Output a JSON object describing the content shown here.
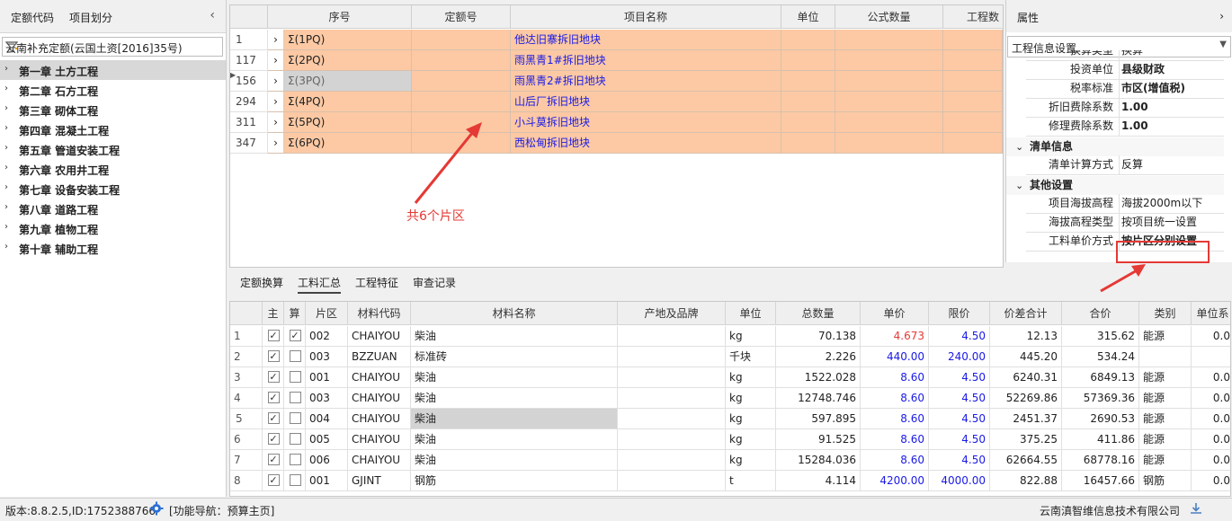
{
  "left_panel": {
    "tabs": [
      "定额代码",
      "项目划分"
    ],
    "quota_source": "云南补充定额(云国土资[2016]35号)",
    "chapters": [
      "第一章 土方工程",
      "第二章 石方工程",
      "第三章 砌体工程",
      "第四章 混凝土工程",
      "第五章 管道安装工程",
      "第六章 农用井工程",
      "第七章 设备安装工程",
      "第八章 道路工程",
      "第九章 植物工程",
      "第十章 辅助工程"
    ]
  },
  "top_grid": {
    "columns": [
      "序号",
      "定额号",
      "项目名称",
      "单位",
      "公式数量",
      "工程数"
    ],
    "rows": [
      {
        "num": "1",
        "seq": "Σ(1PQ)",
        "name": "他达旧寨拆旧地块"
      },
      {
        "num": "117",
        "seq": "Σ(2PQ)",
        "name": "雨黑青1#拆旧地块"
      },
      {
        "num": "156",
        "seq": "Σ(3PQ)",
        "name": "雨黑青2#拆旧地块"
      },
      {
        "num": "294",
        "seq": "Σ(4PQ)",
        "name": "山后厂拆旧地块"
      },
      {
        "num": "311",
        "seq": "Σ(5PQ)",
        "name": "小斗莫拆旧地块"
      },
      {
        "num": "347",
        "seq": "Σ(6PQ)",
        "name": "西松甸拆旧地块"
      }
    ],
    "annotation": "共6个片区"
  },
  "properties": {
    "title": "属性",
    "selector": "工程信息设置",
    "rows_top": [
      {
        "k": "换算类型",
        "v": "换算"
      },
      {
        "k": "投资单位",
        "v": "县级财政"
      },
      {
        "k": "税率标准",
        "v": "市区(增值税)"
      },
      {
        "k": "折旧费除系数",
        "v": "1.00"
      },
      {
        "k": "修理费除系数",
        "v": "1.00"
      }
    ],
    "group1": "清单信息",
    "rows_g1": [
      {
        "k": "清单计算方式",
        "v": "反算"
      }
    ],
    "group2": "其他设置",
    "rows_g2": [
      {
        "k": "项目海拔高程",
        "v": "海拔2000m以下"
      },
      {
        "k": "海拔高程类型",
        "v": "按项目统一设置"
      },
      {
        "k": "工料单价方式",
        "v": "按片区分别设置"
      }
    ]
  },
  "bottom_tabs": [
    "定额换算",
    "工料汇总",
    "工程特征",
    "审查记录"
  ],
  "bottom_grid": {
    "columns": [
      "主",
      "算",
      "片区",
      "材料代码",
      "材料名称",
      "产地及品牌",
      "单位",
      "总数量",
      "单价",
      "限价",
      "价差合计",
      "合价",
      "类别",
      "单位系"
    ],
    "rows": [
      {
        "n": "1",
        "area": "002",
        "code": "CHAIYOU",
        "name": "柴油",
        "unit": "kg",
        "qty": "70.138",
        "price": "4.673",
        "limit": "4.50",
        "diff": "12.13",
        "total": "315.62",
        "cat": "能源",
        "coef": "0.0",
        "m": true,
        "c": true
      },
      {
        "n": "2",
        "area": "003",
        "code": "BZZUAN",
        "name": "标准砖",
        "unit": "千块",
        "qty": "2.226",
        "price": "440.00",
        "limit": "240.00",
        "diff": "445.20",
        "total": "534.24",
        "cat": "",
        "coef": "",
        "m": true,
        "c": false
      },
      {
        "n": "3",
        "area": "001",
        "code": "CHAIYOU",
        "name": "柴油",
        "unit": "kg",
        "qty": "1522.028",
        "price": "8.60",
        "limit": "4.50",
        "diff": "6240.31",
        "total": "6849.13",
        "cat": "能源",
        "coef": "0.0",
        "m": true,
        "c": false
      },
      {
        "n": "4",
        "area": "003",
        "code": "CHAIYOU",
        "name": "柴油",
        "unit": "kg",
        "qty": "12748.746",
        "price": "8.60",
        "limit": "4.50",
        "diff": "52269.86",
        "total": "57369.36",
        "cat": "能源",
        "coef": "0.0",
        "m": true,
        "c": false
      },
      {
        "n": "5",
        "area": "004",
        "code": "CHAIYOU",
        "name": "柴油",
        "unit": "kg",
        "qty": "597.895",
        "price": "8.60",
        "limit": "4.50",
        "diff": "2451.37",
        "total": "2690.53",
        "cat": "能源",
        "coef": "0.0",
        "m": true,
        "c": false
      },
      {
        "n": "6",
        "area": "005",
        "code": "CHAIYOU",
        "name": "柴油",
        "unit": "kg",
        "qty": "91.525",
        "price": "8.60",
        "limit": "4.50",
        "diff": "375.25",
        "total": "411.86",
        "cat": "能源",
        "coef": "0.0",
        "m": true,
        "c": false
      },
      {
        "n": "7",
        "area": "006",
        "code": "CHAIYOU",
        "name": "柴油",
        "unit": "kg",
        "qty": "15284.036",
        "price": "8.60",
        "limit": "4.50",
        "diff": "62664.55",
        "total": "68778.16",
        "cat": "能源",
        "coef": "0.0",
        "m": true,
        "c": false
      },
      {
        "n": "8",
        "area": "001",
        "code": "GJINT",
        "name": "钢筋",
        "unit": "t",
        "qty": "4.114",
        "price": "4200.00",
        "limit": "4000.00",
        "diff": "822.88",
        "total": "16457.66",
        "cat": "钢筋",
        "coef": "0.0",
        "m": true,
        "c": false
      }
    ]
  },
  "status": {
    "version": "版本:8.8.2.5,ID:1752388766",
    "nav": "[功能导航：预算主页]",
    "company": "云南滇智维信息技术有限公司"
  }
}
